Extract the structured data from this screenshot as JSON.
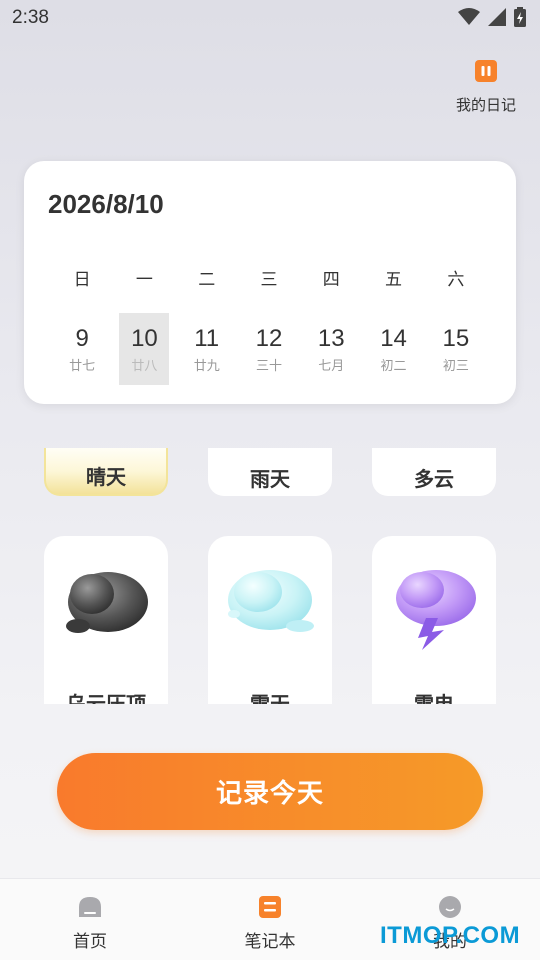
{
  "status_bar": {
    "time": "2:38",
    "icons": [
      "wifi-icon",
      "signal-icon",
      "battery-icon"
    ]
  },
  "diary": {
    "label": "我的日记",
    "icon": "diary-icon",
    "color": "#f7822b"
  },
  "calendar": {
    "date": "2026/8/10",
    "weekdays": [
      "日",
      "一",
      "二",
      "三",
      "四",
      "五",
      "六"
    ],
    "days": [
      {
        "num": "9",
        "lunar": "廿七"
      },
      {
        "num": "10",
        "lunar": "廿八",
        "selected": true
      },
      {
        "num": "11",
        "lunar": "廿九"
      },
      {
        "num": "12",
        "lunar": "三十"
      },
      {
        "num": "13",
        "lunar": "七月"
      },
      {
        "num": "14",
        "lunar": "初二"
      },
      {
        "num": "15",
        "lunar": "初三"
      }
    ]
  },
  "weather": {
    "top_row": [
      {
        "label": "晴天",
        "selected": true
      },
      {
        "label": "雨天"
      },
      {
        "label": "多云"
      }
    ],
    "bottom_row": [
      {
        "label": "乌云压顶",
        "icon": "dark-cloud-icon"
      },
      {
        "label": "雪天",
        "icon": "snow-cloud-icon"
      },
      {
        "label": "雷电",
        "icon": "thunder-cloud-icon"
      }
    ]
  },
  "record_button": {
    "label": "记录今天",
    "color": "#f7822b"
  },
  "bottom_nav": {
    "items": [
      {
        "label": "首页",
        "icon": "home-icon"
      },
      {
        "label": "笔记本",
        "icon": "notebook-icon",
        "active": true
      },
      {
        "label": "我的",
        "icon": "profile-icon"
      }
    ]
  },
  "watermark": "ITMOP.COM"
}
